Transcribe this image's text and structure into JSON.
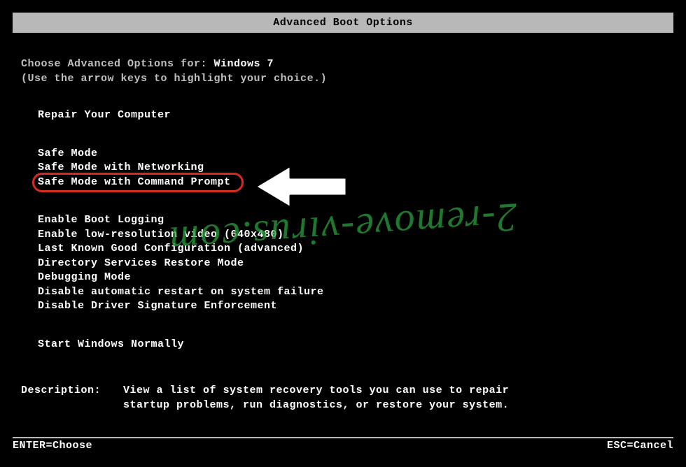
{
  "title": "Advanced Boot Options",
  "prompt_prefix": "Choose Advanced Options for: ",
  "os_name": "Windows 7",
  "hint": "(Use the arrow keys to highlight your choice.)",
  "groups": {
    "repair": [
      "Repair Your Computer"
    ],
    "safe": [
      "Safe Mode",
      "Safe Mode with Networking",
      "Safe Mode with Command Prompt"
    ],
    "advanced": [
      "Enable Boot Logging",
      "Enable low-resolution video (640x480)",
      "Last Known Good Configuration (advanced)",
      "Directory Services Restore Mode",
      "Debugging Mode",
      "Disable automatic restart on system failure",
      "Disable Driver Signature Enforcement"
    ],
    "normal": [
      "Start Windows Normally"
    ]
  },
  "highlighted_option": "Safe Mode with Command Prompt",
  "description": {
    "label": "Description:",
    "text": "View a list of system recovery tools you can use to repair startup problems, run diagnostics, or restore your system."
  },
  "footer": {
    "left": "ENTER=Choose",
    "right": "ESC=Cancel"
  },
  "watermark": "2-remove-virus.com"
}
